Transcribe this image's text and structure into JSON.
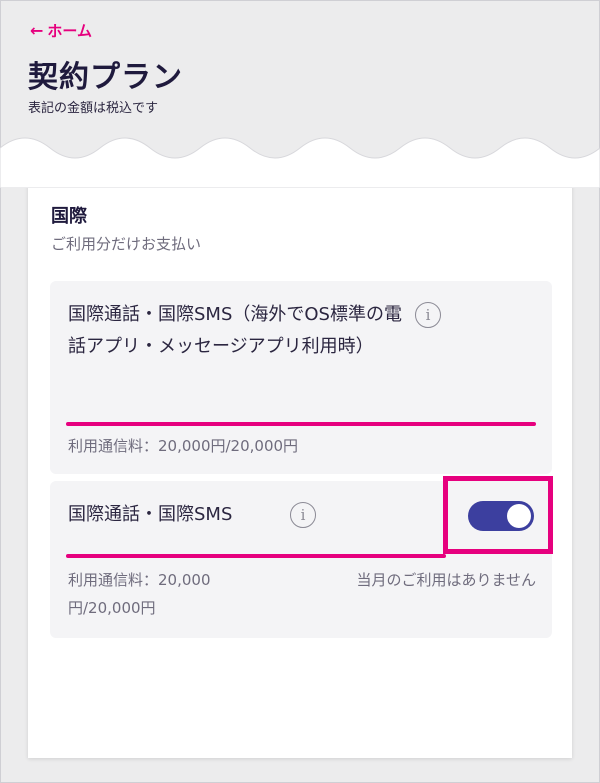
{
  "header": {
    "back_label": "ホーム",
    "title": "契約プラン",
    "subtitle": "表記の金額は税込です"
  },
  "section": {
    "title": "国際",
    "subtitle": "ご利用分だけお支払い"
  },
  "items": [
    {
      "title": "国際通話・国際SMS（海外でOS標準の電話アプリ・メッセージアプリ利用時）",
      "usage": "利用通信料：20,000円/20,000円",
      "usage_fraction": 1.0
    },
    {
      "title": "国際通話・国際SMS",
      "usage": "利用通信料：20,000円/20,000円",
      "usage_fraction": 1.0,
      "status": "当月のご利用はありません",
      "toggle_on": true
    }
  ],
  "colors": {
    "accent": "#e6007e",
    "toggle": "#3c3f9f"
  }
}
